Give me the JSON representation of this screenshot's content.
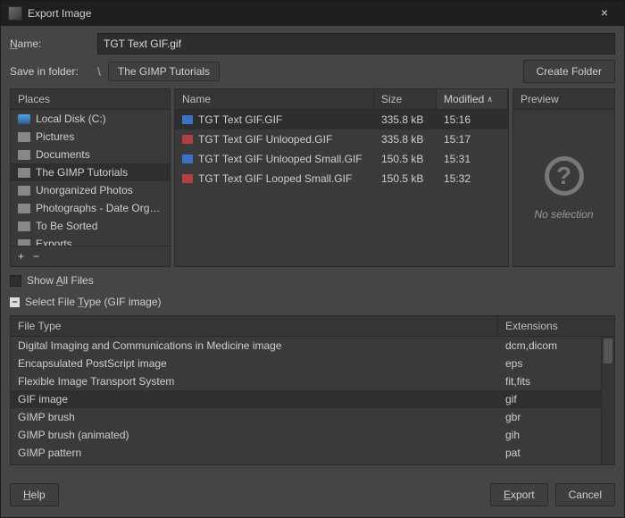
{
  "titlebar": {
    "title": "Export Image",
    "close": "×"
  },
  "nameRow": {
    "label": "Name:",
    "value": "TGT Text GIF.gif"
  },
  "folderRow": {
    "label": "Save in folder:",
    "segments": [
      "The GIMP Tutorials"
    ],
    "createFolder": "Create Folder"
  },
  "places": {
    "header": "Places",
    "items": [
      {
        "label": "Local Disk (C:)",
        "icon": "disk"
      },
      {
        "label": "Pictures",
        "icon": "folder"
      },
      {
        "label": "Documents",
        "icon": "folder"
      },
      {
        "label": "The GIMP Tutorials",
        "icon": "folder",
        "selected": true
      },
      {
        "label": "Unorganized Photos",
        "icon": "folder"
      },
      {
        "label": "Photographs - Date Org…",
        "icon": "folder"
      },
      {
        "label": "To Be Sorted",
        "icon": "folder"
      },
      {
        "label": "Exports",
        "icon": "folder"
      }
    ],
    "add": "+",
    "remove": "−"
  },
  "files": {
    "headers": {
      "name": "Name",
      "size": "Size",
      "modified": "Modified"
    },
    "rows": [
      {
        "name": "TGT Text GIF.GIF",
        "size": "335.8 kB",
        "mod": "15:16",
        "color": "blue",
        "selected": true
      },
      {
        "name": "TGT Text GIF Unlooped.GIF",
        "size": "335.8 kB",
        "mod": "15:17",
        "color": "red"
      },
      {
        "name": "TGT Text GIF Unlooped Small.GIF",
        "size": "150.5 kB",
        "mod": "15:31",
        "color": "blue"
      },
      {
        "name": "TGT Text GIF Looped Small.GIF",
        "size": "150.5 kB",
        "mod": "15:32",
        "color": "red"
      }
    ]
  },
  "preview": {
    "header": "Preview",
    "noSelection": "No selection"
  },
  "showAll": {
    "label": "Show All Files"
  },
  "selectType": {
    "label": "Select File Type (GIF image)"
  },
  "filetypes": {
    "headers": {
      "type": "File Type",
      "ext": "Extensions"
    },
    "rows": [
      {
        "type": "Digital Imaging and Communications in Medicine image",
        "ext": "dcm,dicom"
      },
      {
        "type": "Encapsulated PostScript image",
        "ext": "eps"
      },
      {
        "type": "Flexible Image Transport System",
        "ext": "fit,fits"
      },
      {
        "type": "GIF image",
        "ext": "gif",
        "selected": true
      },
      {
        "type": "GIMP brush",
        "ext": "gbr"
      },
      {
        "type": "GIMP brush (animated)",
        "ext": "gih"
      },
      {
        "type": "GIMP pattern",
        "ext": "pat"
      }
    ]
  },
  "footer": {
    "help": "Help",
    "export": "Export",
    "cancel": "Cancel"
  }
}
